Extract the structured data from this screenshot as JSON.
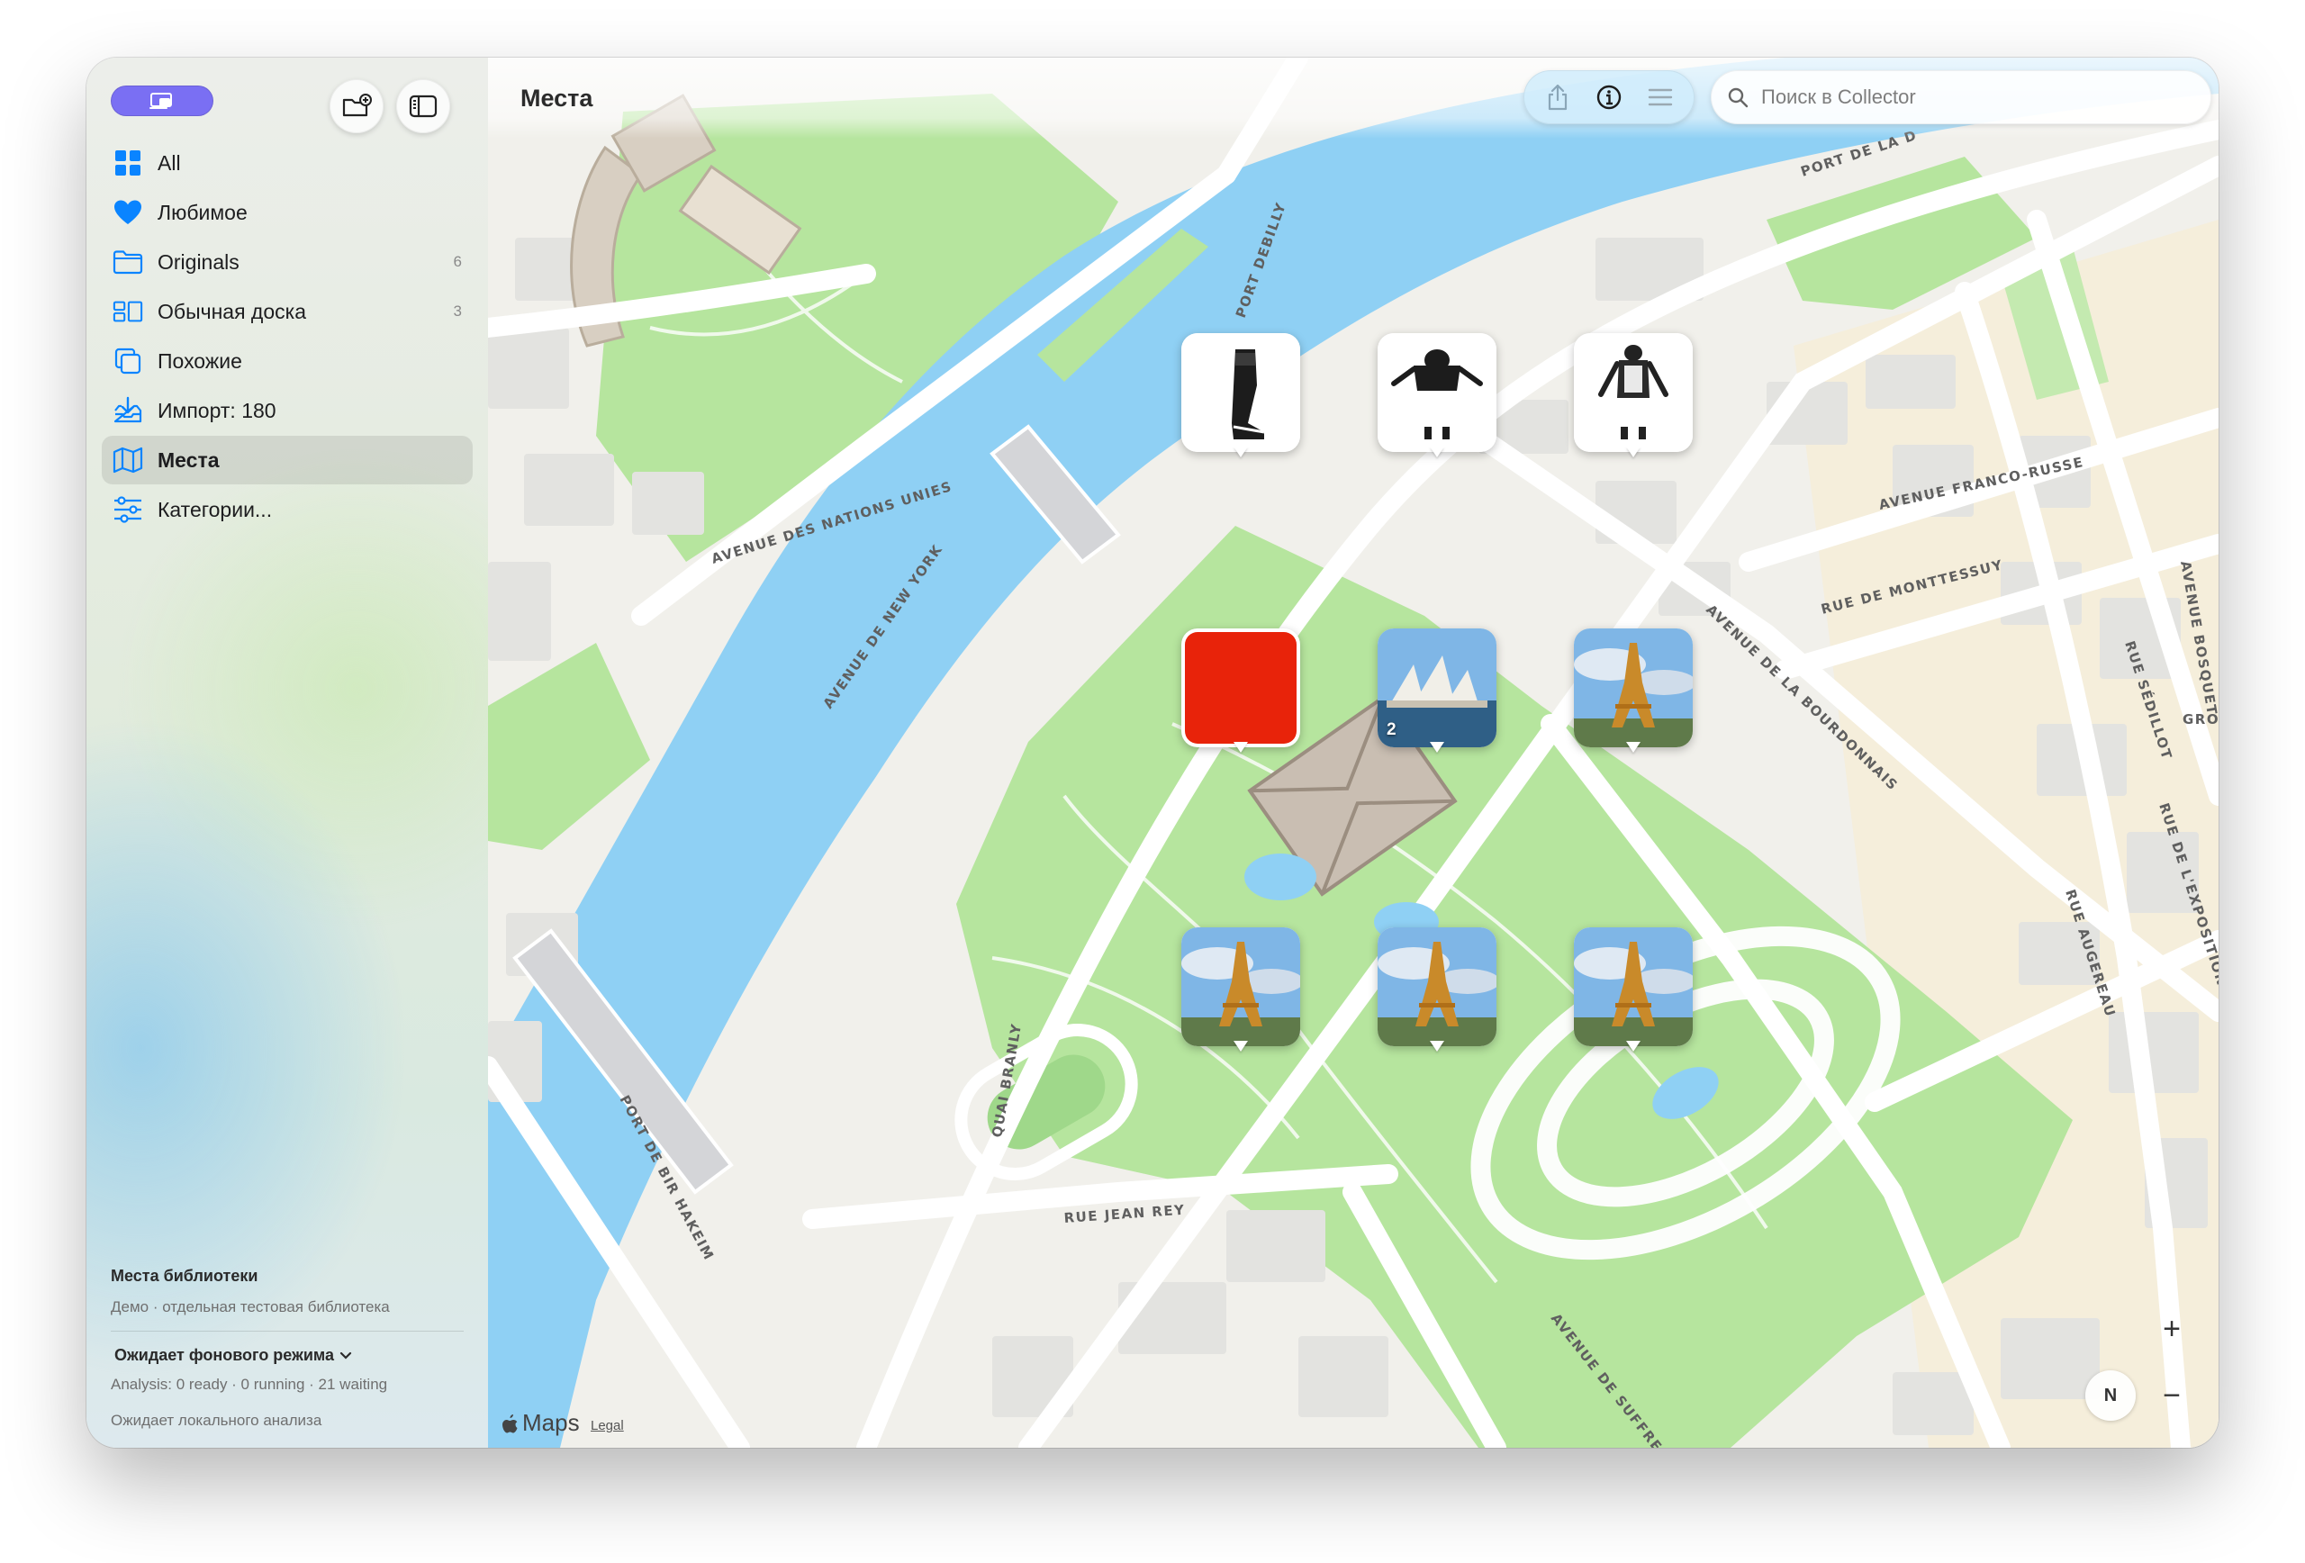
{
  "sidebar": {
    "items": [
      {
        "label": "All",
        "count": "",
        "icon": "grid-icon"
      },
      {
        "label": "Любимое",
        "count": "",
        "icon": "heart-icon"
      },
      {
        "label": "Originals",
        "count": "6",
        "icon": "folder-icon"
      },
      {
        "label": "Обычная доска",
        "count": "3",
        "icon": "board-icon"
      },
      {
        "label": "Похожие",
        "count": "",
        "icon": "stack-icon"
      },
      {
        "label": "Импорт: 180",
        "count": "",
        "icon": "import-tray-icon"
      },
      {
        "label": "Места",
        "count": "",
        "icon": "map-icon",
        "selected": true
      },
      {
        "label": "Категории...",
        "count": "",
        "icon": "sliders-icon"
      }
    ],
    "footer": {
      "library_title": "Места библиотеки",
      "library_subtitle": "Демо · отдельная тестовая библиотека",
      "status": "Ожидает фонового режима",
      "analysis": "Analysis: 0 ready · 0 running · 21 waiting",
      "local": "Ожидает локального анализа"
    }
  },
  "toolbar": {
    "title": "Места",
    "search_placeholder": "Поиск в Collector"
  },
  "map": {
    "street_labels": [
      "AVENUE DES NATIONS UNIES",
      "AVENUE DE NEW YORK",
      "PORT DEBILLY",
      "PORT DE LA D",
      "AVENUE FRANCO-RUSSE",
      "RUE DE MONTTESSUY",
      "AVENUE DE LA BOURDONNAIS",
      "RUE SÉDILLOT",
      "AVENUE BOSQUET",
      "GROS",
      "RUE DE L'EXPOSITION",
      "RUE AUGEREAU",
      "QUAI BRANLY",
      "PORT DE BIR HAKEIM",
      "RUE JEAN REY",
      "AVENUE DE SUFFREN"
    ],
    "pins": [
      {
        "kind": "sneaker",
        "badge": ""
      },
      {
        "kind": "figure-dark",
        "badge": ""
      },
      {
        "kind": "figure-light",
        "badge": ""
      },
      {
        "kind": "red",
        "badge": ""
      },
      {
        "kind": "opera",
        "badge": "2"
      },
      {
        "kind": "eiffel",
        "badge": ""
      },
      {
        "kind": "eiffel",
        "badge": ""
      },
      {
        "kind": "eiffel",
        "badge": ""
      },
      {
        "kind": "eiffel",
        "badge": ""
      }
    ],
    "attribution_logo": "Maps",
    "legal": "Legal",
    "zoom_in": "+",
    "zoom_out": "−",
    "compass": "N"
  },
  "colors": {
    "accent": "#7a6ff3",
    "water": "#8fd0f4",
    "park": "#b6e59e",
    "road": "#ffffff",
    "system_blue": "#0a84ff",
    "red_tile": "#e8230a"
  }
}
